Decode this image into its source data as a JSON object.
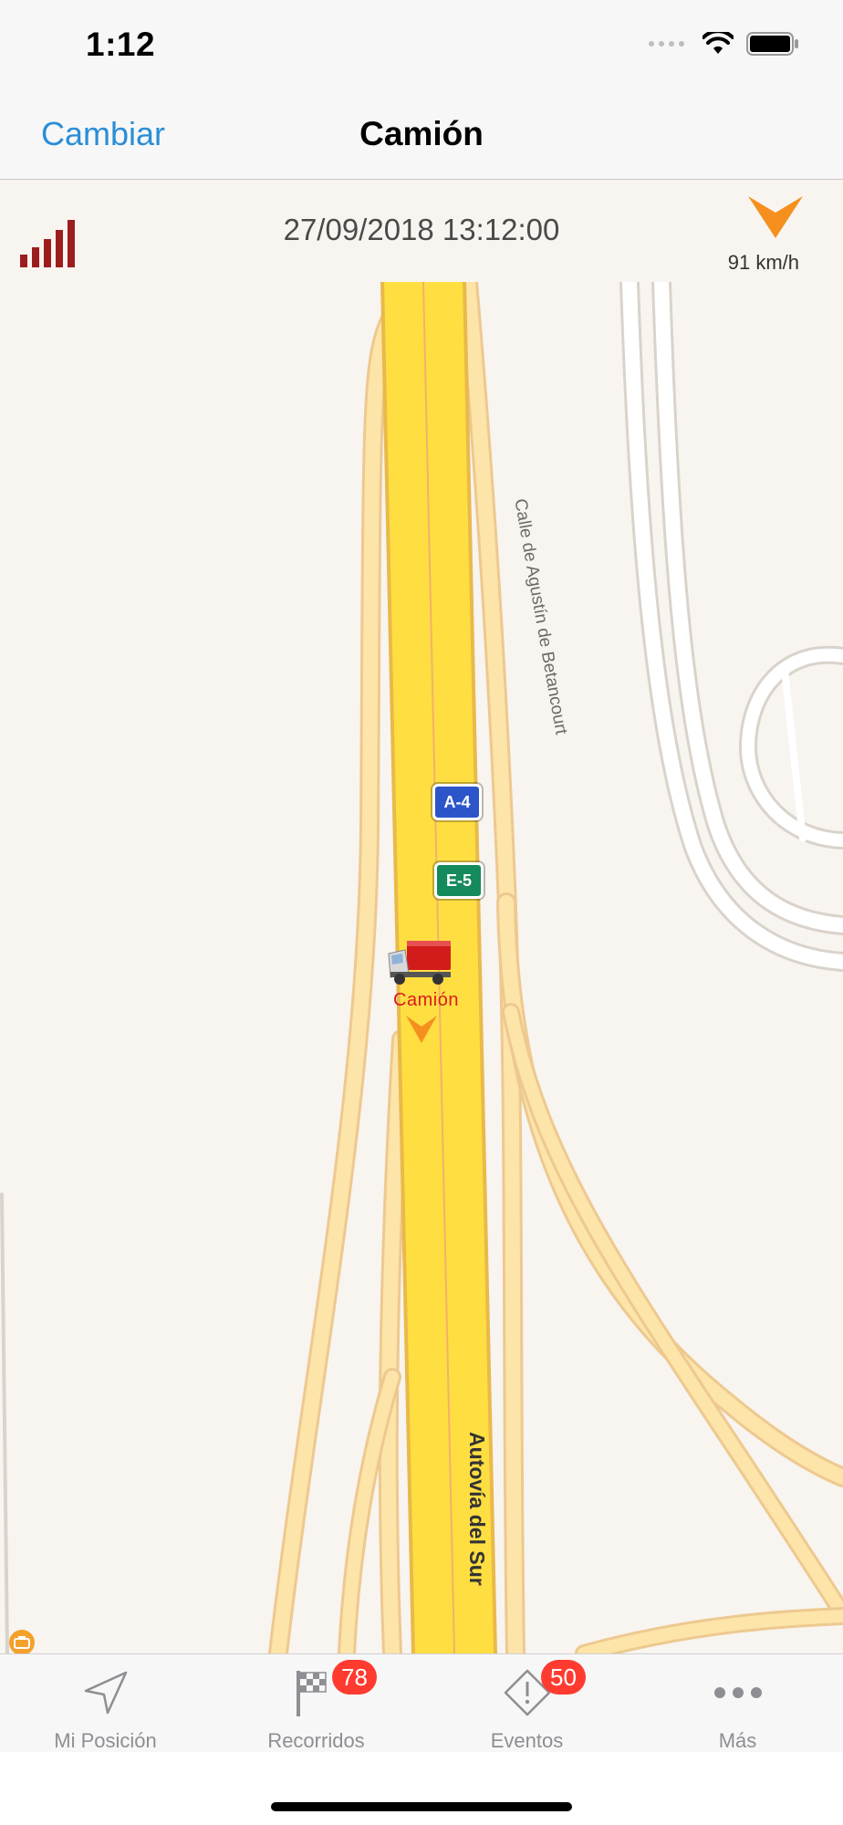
{
  "status_bar": {
    "time": "1:12"
  },
  "nav": {
    "left_button": "Cambiar",
    "title": "Camión"
  },
  "info": {
    "datetime": "27/09/2018 13:12:00",
    "speed": "91 km/h",
    "signal_color": "#9c1d1d",
    "direction_color": "#f5901e"
  },
  "map": {
    "highway_shields": [
      "A-4",
      "E-5"
    ],
    "vehicle_label": "Camión",
    "street_label": "Calle de Agustín de Betancourt",
    "highway_label": "Autovía del Sur"
  },
  "tabs": [
    {
      "label": "Mi Posición",
      "icon": "location-arrow-icon",
      "badge": ""
    },
    {
      "label": "Recorridos",
      "icon": "checkered-flag-icon",
      "badge": "78"
    },
    {
      "label": "Eventos",
      "icon": "warning-icon",
      "badge": "50"
    },
    {
      "label": "Más",
      "icon": "more-dots-icon",
      "badge": ""
    }
  ],
  "colors": {
    "accent": "#2b8ed6",
    "badge": "#ff3b30",
    "highway": "#ffde42",
    "road": "#fde4a9"
  }
}
